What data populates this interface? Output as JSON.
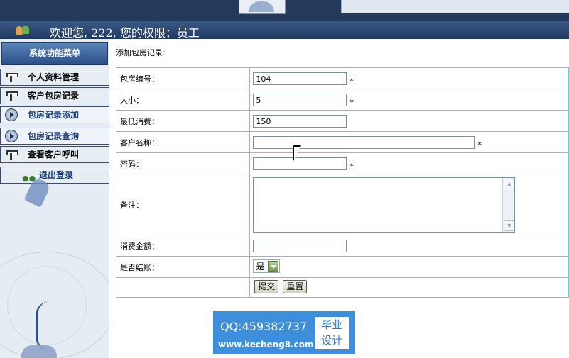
{
  "header": {
    "welcome": "欢迎您, 222, 您的权限：员工"
  },
  "sidebar": {
    "title": "系统功能菜单",
    "items": [
      {
        "label": "个人资料管理",
        "icon": "wrench-icon"
      },
      {
        "label": "客户包房记录",
        "icon": "wrench-icon"
      },
      {
        "label": "包房记录添加",
        "icon": "play-icon"
      },
      {
        "label": "包房记录查询",
        "icon": "play-icon"
      },
      {
        "label": "查看客户呼叫",
        "icon": "wrench-icon"
      }
    ],
    "logout_label": "退出登录"
  },
  "form": {
    "title": "添加包房记录:",
    "required_mark": "*",
    "room_no_label": "包房编号：",
    "room_no_value": "104",
    "size_label": "大小：",
    "size_value": "5",
    "min_spend_label": "最低消费：",
    "min_spend_value": "150",
    "customer_label": "客户名称：",
    "customer_value": "",
    "password_label": "密码：",
    "password_value": "",
    "remark_label": "备注：",
    "amount_label": "消费金额：",
    "amount_value": "",
    "settled_label": "是否结账：",
    "settled_value": "是",
    "submit_label": "提交",
    "reset_label": "重置"
  },
  "watermark": {
    "qq": "QQ:459382737",
    "site": "www.kecheng8.com",
    "badge_line1": "毕业",
    "badge_line2": "设计"
  }
}
